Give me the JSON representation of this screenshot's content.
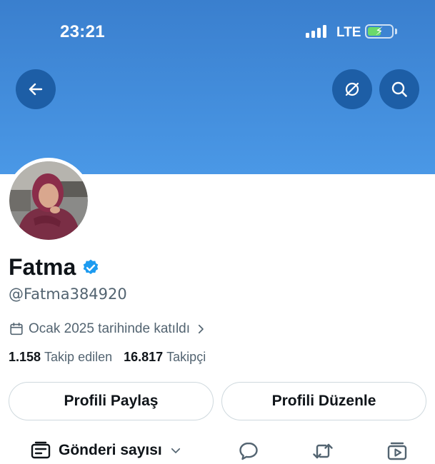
{
  "status_bar": {
    "time": "23:21",
    "network": "LTE",
    "battery_level": 0.55,
    "battery_color": "#6bd96b"
  },
  "header": {
    "banner_color": "#4a98e6",
    "button_color": "#1d5ea6",
    "icons": [
      "arrow-left-icon",
      "eye-slash-icon",
      "search-icon"
    ]
  },
  "profile": {
    "name": "Fatma",
    "handle": "@Fatma384920",
    "joined": "Ocak 2025 tarihinde katıldı",
    "following_count": "1.158",
    "following_label": "Takip edilen",
    "followers_count": "16.817",
    "followers_label": "Takipçi",
    "verified_color": "#1d9bf0"
  },
  "buttons": {
    "share": "Profili Paylaş",
    "edit": "Profili Düzenle"
  },
  "bottom_bar": {
    "filter_label": "Gönderi sayısı",
    "tab_icons": [
      "reply-icon",
      "repost-icon",
      "media-icon"
    ]
  }
}
